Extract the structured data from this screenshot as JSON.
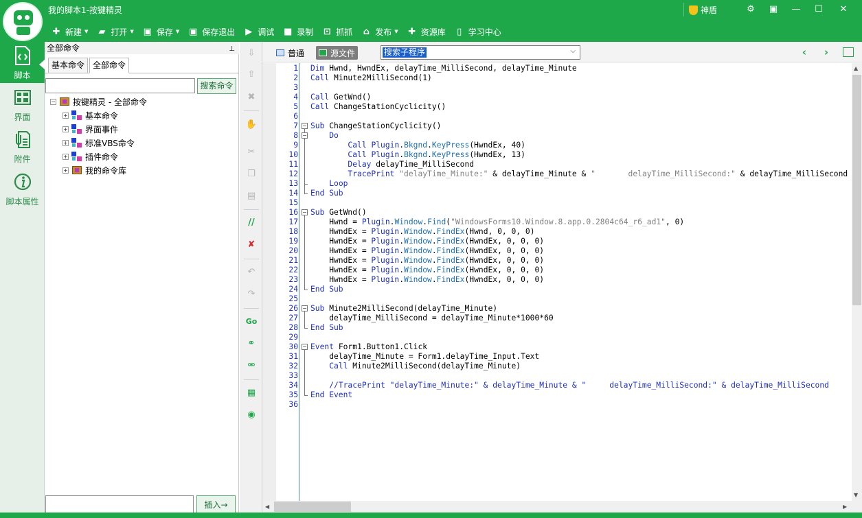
{
  "app": {
    "title": "我的脚本1-按键精灵",
    "shield_label": "神盾",
    "brand_color": "#1ea84a"
  },
  "toolbar": [
    {
      "label": "新建",
      "icon": "plus-icon",
      "dropdown": true
    },
    {
      "label": "打开",
      "icon": "folder-icon",
      "dropdown": true
    },
    {
      "label": "保存",
      "icon": "save-icon",
      "dropdown": true
    },
    {
      "label": "保存退出",
      "icon": "save-exit-icon",
      "dropdown": false
    },
    {
      "label": "调试",
      "icon": "play-icon",
      "dropdown": false
    },
    {
      "label": "录制",
      "icon": "camera-icon",
      "dropdown": false
    },
    {
      "label": "抓抓",
      "icon": "grab-icon",
      "dropdown": false
    },
    {
      "label": "发布",
      "icon": "publish-icon",
      "dropdown": true
    },
    {
      "label": "资源库",
      "icon": "resource-icon",
      "dropdown": false
    },
    {
      "label": "学习中心",
      "icon": "book-icon",
      "dropdown": false
    }
  ],
  "leftnav": [
    {
      "label": "脚本",
      "icon": "script-icon",
      "active": true
    },
    {
      "label": "界面",
      "icon": "interface-icon",
      "active": false
    },
    {
      "label": "附件",
      "icon": "attachment-icon",
      "active": false
    },
    {
      "label": "脚本属性",
      "icon": "info-icon",
      "active": false
    }
  ],
  "commands": {
    "header": "全部命令",
    "tabs": [
      "基本命令",
      "全部命令"
    ],
    "active_tab": "全部命令",
    "search_placeholder": "",
    "search_button": "搜索命令",
    "tree_root": "按键精灵 - 全部命令",
    "tree_items": [
      "基本命令",
      "界面事件",
      "标准VBS命令",
      "插件命令",
      "我的命令库"
    ],
    "insert_button": "插入→"
  },
  "editor": {
    "tab_normal": "普通",
    "tab_source": "源文件",
    "sub_select_value": "搜索子程序"
  },
  "code": {
    "line_count": 36,
    "lines": [
      [
        [
          "kw",
          "Dim"
        ],
        [
          "t",
          " Hwnd, HwndEx, delayTime_MilliSecond, delayTime_Minute"
        ]
      ],
      [
        [
          "kw",
          "Call"
        ],
        [
          "t",
          " Minute2MilliSecond(1)"
        ]
      ],
      [],
      [
        [
          "kw",
          "Call"
        ],
        [
          "t",
          " GetWnd()"
        ]
      ],
      [
        [
          "kw",
          "Call"
        ],
        [
          "t",
          " ChangeStationCyclicity()"
        ]
      ],
      [],
      [
        [
          "kw",
          "Sub"
        ],
        [
          "t",
          " ChangeStationCyclicity()"
        ]
      ],
      [
        [
          "t",
          "    "
        ],
        [
          "kw",
          "Do"
        ]
      ],
      [
        [
          "t",
          "        "
        ],
        [
          "kw",
          "Call"
        ],
        [
          "t",
          " "
        ],
        [
          "pl",
          "Plugin"
        ],
        [
          "t",
          "."
        ],
        [
          "mt",
          "Bkgnd"
        ],
        [
          "t",
          "."
        ],
        [
          "mt",
          "KeyPress"
        ],
        [
          "t",
          "(HwndEx, 40)"
        ]
      ],
      [
        [
          "t",
          "        "
        ],
        [
          "kw",
          "Call"
        ],
        [
          "t",
          " "
        ],
        [
          "pl",
          "Plugin"
        ],
        [
          "t",
          "."
        ],
        [
          "mt",
          "Bkgnd"
        ],
        [
          "t",
          "."
        ],
        [
          "mt",
          "KeyPress"
        ],
        [
          "t",
          "(HwndEx, 13)"
        ]
      ],
      [
        [
          "t",
          "        "
        ],
        [
          "kw",
          "Delay"
        ],
        [
          "t",
          " delayTime_MilliSecond"
        ]
      ],
      [
        [
          "t",
          "        "
        ],
        [
          "kw",
          "TracePrint"
        ],
        [
          "t",
          " "
        ],
        [
          "str",
          "\"delayTime_Minute:\""
        ],
        [
          "t",
          " & delayTime_Minute & "
        ],
        [
          "str",
          "\"       delayTime_MilliSecond:\""
        ],
        [
          "t",
          " & delayTime_MilliSecond"
        ]
      ],
      [
        [
          "t",
          "    "
        ],
        [
          "kw",
          "Loop"
        ]
      ],
      [
        [
          "kw",
          "End Sub"
        ]
      ],
      [],
      [
        [
          "kw",
          "Sub"
        ],
        [
          "t",
          " GetWnd()"
        ]
      ],
      [
        [
          "t",
          "    Hwnd = "
        ],
        [
          "pl",
          "Plugin"
        ],
        [
          "t",
          "."
        ],
        [
          "mt",
          "Window"
        ],
        [
          "t",
          "."
        ],
        [
          "mt",
          "Find"
        ],
        [
          "t",
          "("
        ],
        [
          "str",
          "\"WindowsForms10.Window.8.app.0.2804c64_r6_ad1\""
        ],
        [
          "t",
          ", 0)"
        ]
      ],
      [
        [
          "t",
          "    HwndEx = "
        ],
        [
          "pl",
          "Plugin"
        ],
        [
          "t",
          "."
        ],
        [
          "mt",
          "Window"
        ],
        [
          "t",
          "."
        ],
        [
          "mt",
          "FindEx"
        ],
        [
          "t",
          "(Hwnd, 0, 0, 0)"
        ]
      ],
      [
        [
          "t",
          "    HwndEx = "
        ],
        [
          "pl",
          "Plugin"
        ],
        [
          "t",
          "."
        ],
        [
          "mt",
          "Window"
        ],
        [
          "t",
          "."
        ],
        [
          "mt",
          "FindEx"
        ],
        [
          "t",
          "(HwndEx, 0, 0, 0)"
        ]
      ],
      [
        [
          "t",
          "    HwndEx = "
        ],
        [
          "pl",
          "Plugin"
        ],
        [
          "t",
          "."
        ],
        [
          "mt",
          "Window"
        ],
        [
          "t",
          "."
        ],
        [
          "mt",
          "FindEx"
        ],
        [
          "t",
          "(HwndEx, 0, 0, 0)"
        ]
      ],
      [
        [
          "t",
          "    HwndEx = "
        ],
        [
          "pl",
          "Plugin"
        ],
        [
          "t",
          "."
        ],
        [
          "mt",
          "Window"
        ],
        [
          "t",
          "."
        ],
        [
          "mt",
          "FindEx"
        ],
        [
          "t",
          "(HwndEx, 0, 0, 0)"
        ]
      ],
      [
        [
          "t",
          "    HwndEx = "
        ],
        [
          "pl",
          "Plugin"
        ],
        [
          "t",
          "."
        ],
        [
          "mt",
          "Window"
        ],
        [
          "t",
          "."
        ],
        [
          "mt",
          "FindEx"
        ],
        [
          "t",
          "(HwndEx, 0, 0, 0)"
        ]
      ],
      [
        [
          "t",
          "    HwndEx = "
        ],
        [
          "pl",
          "Plugin"
        ],
        [
          "t",
          "."
        ],
        [
          "mt",
          "Window"
        ],
        [
          "t",
          "."
        ],
        [
          "mt",
          "FindEx"
        ],
        [
          "t",
          "(HwndEx, 0, 0, 0)"
        ]
      ],
      [
        [
          "kw",
          "End Sub"
        ]
      ],
      [],
      [
        [
          "kw",
          "Sub"
        ],
        [
          "t",
          " Minute2MilliSecond(delayTime_Minute)"
        ]
      ],
      [
        [
          "t",
          "    delayTime_MilliSecond = delayTime_Minute*1000*60"
        ]
      ],
      [
        [
          "kw",
          "End Sub"
        ]
      ],
      [],
      [
        [
          "kw",
          "Event"
        ],
        [
          "t",
          " Form1.Button1.Click"
        ]
      ],
      [
        [
          "t",
          "    delayTime_Minute = Form1.delayTime_Input.Text"
        ]
      ],
      [
        [
          "t",
          "    "
        ],
        [
          "kw",
          "Call"
        ],
        [
          "t",
          " Minute2MilliSecond(delayTime_Minute)"
        ]
      ],
      [],
      [
        [
          "cm",
          "    //TracePrint \"delayTime_Minute:\" & delayTime_Minute & \"     delayTime_MilliSecond:\" & delayTime_MilliSecond"
        ]
      ],
      [
        [
          "kw",
          "End Event"
        ]
      ],
      []
    ]
  }
}
